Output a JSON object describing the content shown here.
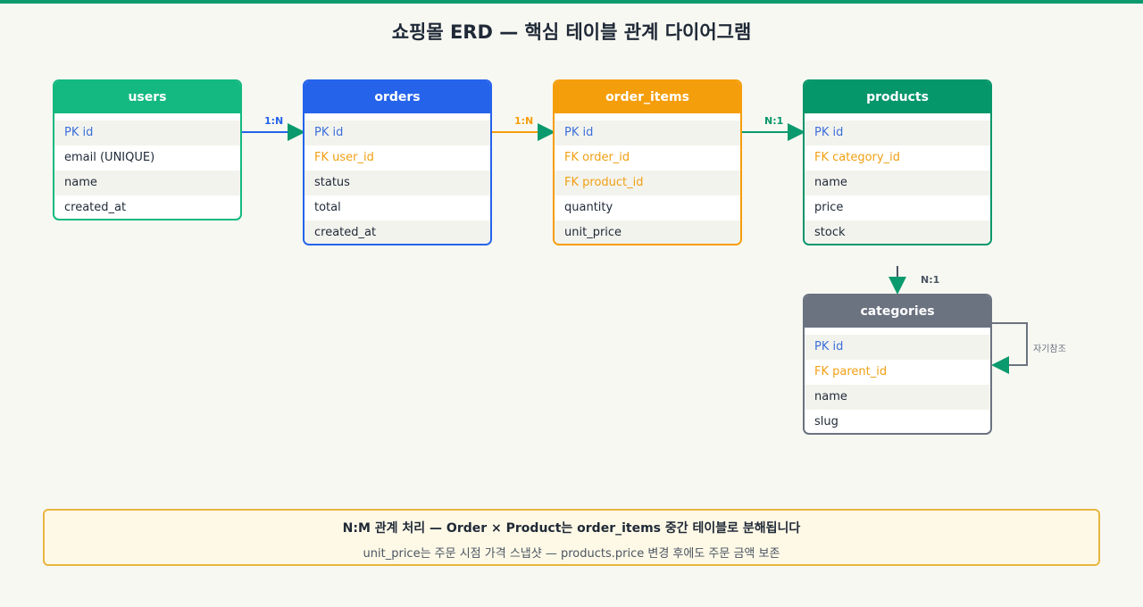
{
  "title": "쇼핑몰 ERD — 핵심 테이블 관계 다이어그램",
  "colors": {
    "users": "#13b981",
    "orders": "#2563eb",
    "order_items": "#f59e0b",
    "products": "#05966a",
    "categories": "#6b7280",
    "pk": "#3b6fd8",
    "fk": "#f0a013"
  },
  "entities": {
    "users": {
      "name": "users",
      "rows": [
        "PK id",
        "email (UNIQUE)",
        "name",
        "created_at"
      ]
    },
    "orders": {
      "name": "orders",
      "rows": [
        "PK id",
        "FK user_id",
        "status",
        "total",
        "created_at"
      ]
    },
    "order_items": {
      "name": "order_items",
      "rows": [
        "PK id",
        "FK order_id",
        "FK product_id",
        "quantity",
        "unit_price"
      ]
    },
    "products": {
      "name": "products",
      "rows": [
        "PK id",
        "FK category_id",
        "name",
        "price",
        "stock"
      ]
    },
    "categories": {
      "name": "categories",
      "rows": [
        "PK id",
        "FK parent_id",
        "name",
        "slug"
      ]
    }
  },
  "relations": {
    "users_orders": "1:N",
    "orders_items": "1:N",
    "items_products": "N:1",
    "products_categories": "N:1",
    "self_reference": "자기참조"
  },
  "note": {
    "title": "N:M 관계 처리 — Order × Product는 order_items 중간 테이블로 분해됩니다",
    "subtitle": "unit_price는 주문 시점 가격 스냅샷 — products.price 변경 후에도 주문 금액 보존"
  }
}
